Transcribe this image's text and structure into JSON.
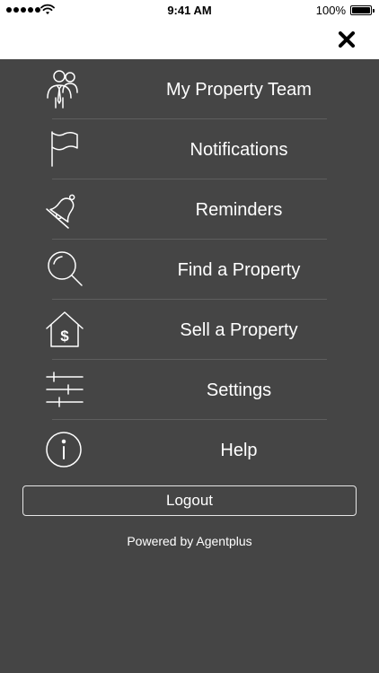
{
  "status_bar": {
    "time": "9:41 AM",
    "battery_percent": "100%",
    "signal_icon": "signal-dots-icon",
    "wifi_icon": "wifi-icon",
    "battery_icon": "battery-icon"
  },
  "header": {
    "close_icon": "close-icon"
  },
  "menu": {
    "items": [
      {
        "label": "My Property Team",
        "icon": "team-icon"
      },
      {
        "label": "Notifications",
        "icon": "flag-icon"
      },
      {
        "label": "Reminders",
        "icon": "bell-off-icon"
      },
      {
        "label": "Find a Property",
        "icon": "search-icon"
      },
      {
        "label": "Sell a Property",
        "icon": "house-dollar-icon"
      },
      {
        "label": "Settings",
        "icon": "sliders-icon"
      },
      {
        "label": "Help",
        "icon": "info-icon"
      }
    ]
  },
  "logout_label": "Logout",
  "footer": {
    "powered_by": "Powered by Agentplus"
  },
  "colors": {
    "background": "#454545",
    "text": "#ffffff",
    "top_bar": "#ffffff",
    "divider": "#5e5e5e"
  }
}
